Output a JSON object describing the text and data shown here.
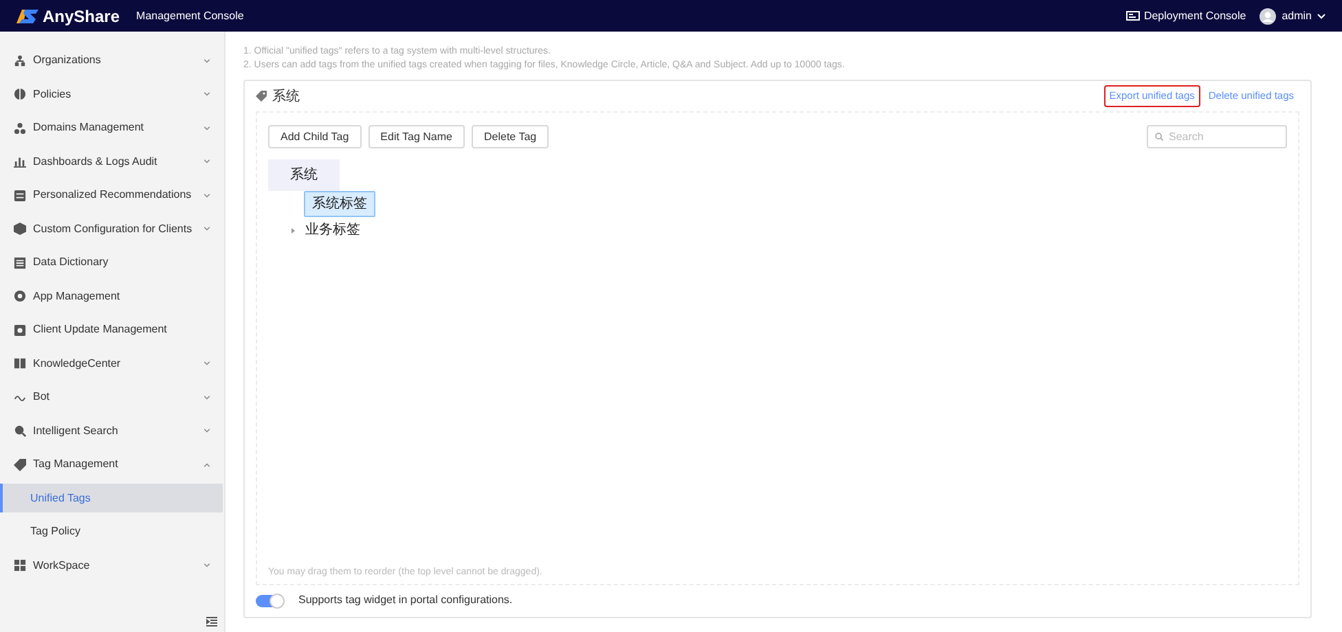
{
  "header": {
    "logo": "AnyShare",
    "title": "Management Console",
    "deployment_console": "Deployment Console",
    "user": "admin"
  },
  "sidebar": {
    "items": [
      {
        "label": "Organizations",
        "expandable": true,
        "expanded": false
      },
      {
        "label": "Policies",
        "expandable": true,
        "expanded": false
      },
      {
        "label": "Domains Management",
        "expandable": true,
        "expanded": false
      },
      {
        "label": "Dashboards & Logs Audit",
        "expandable": true,
        "expanded": false
      },
      {
        "label": "Personalized Recommendations",
        "expandable": true,
        "expanded": false
      },
      {
        "label": "Custom Configuration for Clients",
        "expandable": true,
        "expanded": false
      },
      {
        "label": "Data Dictionary",
        "expandable": false
      },
      {
        "label": "App Management",
        "expandable": false
      },
      {
        "label": "Client Update Management",
        "expandable": false
      },
      {
        "label": "KnowledgeCenter",
        "expandable": true,
        "expanded": false
      },
      {
        "label": "Bot",
        "expandable": true,
        "expanded": false
      },
      {
        "label": "Intelligent Search",
        "expandable": true,
        "expanded": false
      },
      {
        "label": "Tag Management",
        "expandable": true,
        "expanded": true,
        "children": [
          {
            "label": "Unified Tags",
            "selected": true
          },
          {
            "label": "Tag Policy",
            "selected": false
          }
        ]
      },
      {
        "label": "WorkSpace",
        "expandable": true,
        "expanded": false
      }
    ]
  },
  "notes": [
    "1. Official \"unified tags\" refers to a tag system with multi-level structures.",
    "2. Users can add tags from the unified tags created when tagging for files, Knowledge Circle, Article, Q&A and Subject. Add up to 10000 tags."
  ],
  "panel": {
    "title": "系统",
    "links": [
      {
        "label": "Export unified tags",
        "highlighted": true
      },
      {
        "label": "Delete unified tags",
        "highlighted": false
      }
    ],
    "buttons": [
      "Add Child Tag",
      "Edit Tag Name",
      "Delete Tag"
    ],
    "search": {
      "placeholder": "Search"
    },
    "tree": [
      {
        "label": "系统",
        "selected": false,
        "children": [
          {
            "label": "系统标签",
            "selected": true
          },
          {
            "label": "业务标签",
            "selected": false,
            "expanded": false
          }
        ]
      }
    ],
    "hint": "You may drag them to reorder (the top level cannot be dragged).",
    "toggle": {
      "label": "Supports tag widget in portal configurations.",
      "on": true
    }
  }
}
